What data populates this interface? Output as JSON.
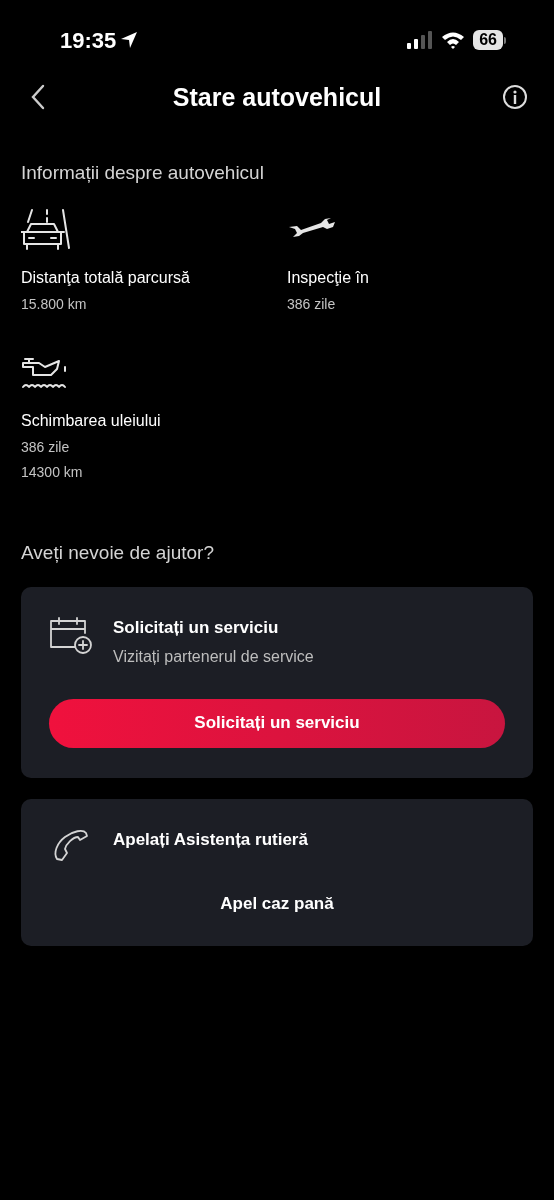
{
  "status_bar": {
    "time": "19:35",
    "battery": "66"
  },
  "header": {
    "title": "Stare autovehicul"
  },
  "vehicle_info": {
    "heading": "Informații despre autovehicul",
    "items": [
      {
        "kind": "road",
        "label": "Distanţa totală parcursă",
        "values": [
          "15.800 km"
        ]
      },
      {
        "kind": "wrench",
        "label": "Inspecţie în",
        "values": [
          "386 zile"
        ]
      },
      {
        "kind": "oil",
        "label": "Schimbarea uleiului",
        "values": [
          "386 zile",
          "14300 km"
        ]
      }
    ]
  },
  "help": {
    "heading": "Aveți nevoie de ajutor?",
    "cards": [
      {
        "kind": "calendar",
        "title": "Solicitați un serviciu",
        "subtitle": "Vizitați partenerul de service",
        "action": {
          "kind": "primary",
          "label": "Solicitați un serviciu"
        }
      },
      {
        "kind": "phone",
        "title": "Apelați Asistența rutieră",
        "action": {
          "kind": "text",
          "label": "Apel caz pană"
        }
      }
    ]
  }
}
